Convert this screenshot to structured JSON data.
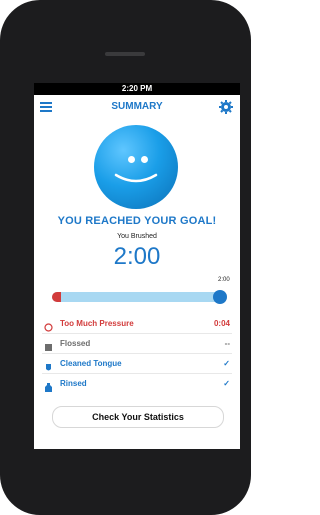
{
  "status_bar": {
    "time": "2:20 PM"
  },
  "header": {
    "title": "SUMMARY",
    "menu_icon": "hamburger-icon",
    "settings_icon": "gear-icon"
  },
  "goal": {
    "message": "YOU REACHED YOUR GOAL!"
  },
  "brush": {
    "label": "You Brushed",
    "time": "2:00"
  },
  "progress": {
    "end_label": "2:00",
    "value_fraction": 1.0
  },
  "checklist": [
    {
      "label": "Too Much Pressure",
      "value": "0:04",
      "color": "#d23b3b",
      "icon": "pressure-warning-icon"
    },
    {
      "label": "Flossed",
      "value": "--",
      "color": "#6d6d6d",
      "icon": "floss-icon"
    },
    {
      "label": "Cleaned Tongue",
      "value": "✓",
      "color": "#1e78c8",
      "icon": "tongue-icon"
    },
    {
      "label": "Rinsed",
      "value": "✓",
      "color": "#1e78c8",
      "icon": "rinse-icon"
    }
  ],
  "actions": {
    "statistics_button": "Check Your Statistics"
  },
  "colors": {
    "accent": "#1e78c8",
    "warning": "#d23b3b"
  }
}
